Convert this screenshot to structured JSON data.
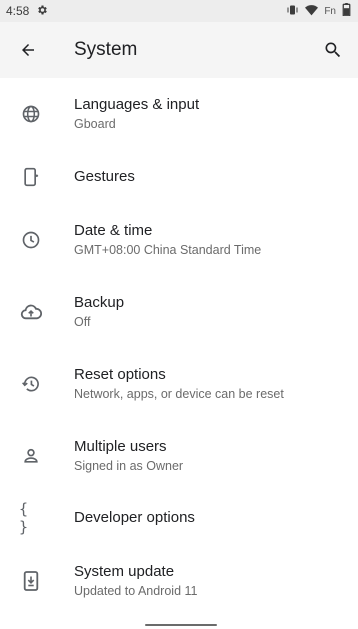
{
  "status_bar": {
    "time": "4:58",
    "carrier_label": "Fn"
  },
  "app_bar": {
    "title": "System"
  },
  "items": [
    {
      "title": "Languages & input",
      "subtitle": "Gboard",
      "icon": "globe-icon"
    },
    {
      "title": "Gestures",
      "subtitle": "",
      "icon": "phone-gesture-icon"
    },
    {
      "title": "Date & time",
      "subtitle": "GMT+08:00 China Standard Time",
      "icon": "clock-icon"
    },
    {
      "title": "Backup",
      "subtitle": "Off",
      "icon": "cloud-upload-icon"
    },
    {
      "title": "Reset options",
      "subtitle": "Network, apps, or device can be reset",
      "icon": "history-icon"
    },
    {
      "title": "Multiple users",
      "subtitle": "Signed in as Owner",
      "icon": "person-icon"
    },
    {
      "title": "Developer options",
      "subtitle": "",
      "icon": "braces-icon",
      "icon_text": "{ }"
    },
    {
      "title": "System update",
      "subtitle": "Updated to Android 11",
      "icon": "system-update-icon"
    }
  ],
  "colors": {
    "status_bar_bg": "#ededed",
    "app_bar_bg": "#f5f5f5",
    "icon": "#5f6368",
    "primary_text": "#202124",
    "secondary_text": "#6b6b6b"
  }
}
